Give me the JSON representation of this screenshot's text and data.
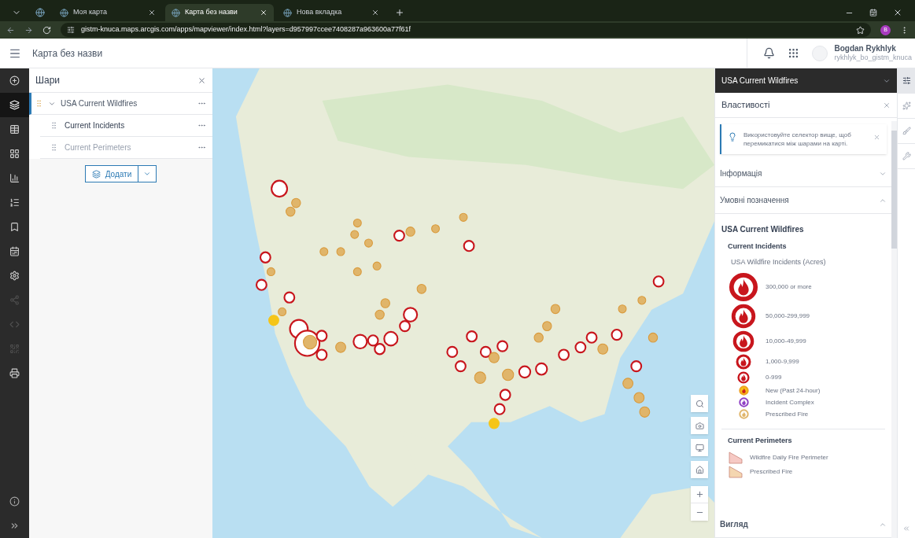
{
  "browser": {
    "tabs": [
      {
        "title": "Моя карта",
        "selected": false
      },
      {
        "title": "Карта без назви",
        "selected": true
      },
      {
        "title": "Нова вкладка",
        "selected": false
      }
    ],
    "url": "gistm-knuca.maps.arcgis.com/apps/mapviewer/index.html?layers=d957997ccee7408287a963600a77f61f",
    "profile_initial": "B"
  },
  "header": {
    "title": "Карта без назви",
    "user_name": "Bogdan Rykhlyk",
    "user_login": "rykhlyk_bo_gistm_knuca"
  },
  "left_toolbar": [
    {
      "selected": false,
      "disabled": false
    },
    {
      "selected": true,
      "disabled": false
    },
    {
      "selected": false,
      "disabled": false
    },
    {
      "selected": false,
      "disabled": false
    },
    {
      "selected": false,
      "disabled": false
    },
    {
      "selected": false,
      "disabled": false
    },
    {
      "selected": false,
      "disabled": false
    },
    {
      "selected": false,
      "disabled": false
    },
    {
      "selected": false,
      "disabled": false
    },
    {
      "selected": false,
      "disabled": true
    },
    {
      "selected": false,
      "disabled": true
    },
    {
      "selected": false,
      "disabled": true
    },
    {
      "selected": false,
      "disabled": false
    }
  ],
  "layers_panel": {
    "title": "Шари",
    "add_button": "Додати",
    "layers": [
      {
        "name": "USA Current Wildfires",
        "selected": true,
        "expanded": true,
        "children": [
          {
            "name": "Current Incidents",
            "visible": true
          },
          {
            "name": "Current Perimeters",
            "visible": false
          }
        ]
      }
    ]
  },
  "properties_panel": {
    "layer_selector": "USA Current Wildfires",
    "title": "Властивості",
    "tip": "Використовуйте селектор вище, щоб перемикатися між шарами на карті.",
    "sections": [
      {
        "title": "Інформація",
        "expanded": false
      },
      {
        "title": "Умовні позначення",
        "expanded": true
      },
      {
        "title": "Вигляд",
        "expanded": true
      }
    ],
    "legend": {
      "layer": "USA Current Wildfires",
      "groups": [
        {
          "title": "Current Incidents",
          "subtitle": "USA Wildfire Incidents (Acres)",
          "items": [
            {
              "kind": "size",
              "label": "300,000 or more",
              "color": "#c8161d"
            },
            {
              "kind": "size",
              "label": "50,000-299,999",
              "color": "#c8161d"
            },
            {
              "kind": "size",
              "label": "10,000-49,999",
              "color": "#c8161d"
            },
            {
              "kind": "size",
              "label": "1,000-9,999",
              "color": "#c8161d"
            },
            {
              "kind": "size",
              "label": "0-999",
              "color": "#c8161d"
            },
            {
              "kind": "new",
              "label": "New (Past 24-hour)",
              "color": "#f5c518"
            },
            {
              "kind": "complex",
              "label": "Incident Complex",
              "color": "#8e3fc4"
            },
            {
              "kind": "prescribed",
              "label": "Prescribed Fire",
              "color": "#e0b56a"
            }
          ]
        },
        {
          "title": "Current Perimeters",
          "items": [
            {
              "kind": "area",
              "label": "Wildfire Daily Fire Perimeter",
              "color": "#f6c9c4"
            },
            {
              "kind": "area",
              "label": "Prescribed Fire",
              "color": "#f4d6b0"
            }
          ]
        }
      ]
    }
  },
  "right_toolbar": [
    {
      "selected": true
    },
    {
      "selected": false
    },
    {
      "selected": false
    },
    {
      "selected": false
    }
  ]
}
